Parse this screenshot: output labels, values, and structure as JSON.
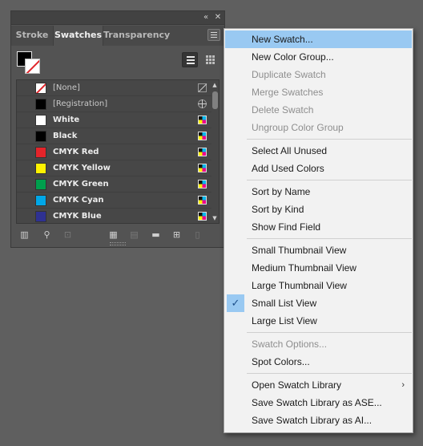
{
  "panel": {
    "titlebar_buttons": [
      "«",
      "✕"
    ],
    "tabs": [
      {
        "label": "Stroke",
        "active": false
      },
      {
        "label": "Swatches",
        "active": true
      },
      {
        "label": "Transparency",
        "active": false
      }
    ],
    "swatches": [
      {
        "name": "[None]",
        "color": "none",
        "type": "none"
      },
      {
        "name": "[Registration]",
        "color": "#000000",
        "type": "registration"
      },
      {
        "name": "White",
        "color": "#ffffff",
        "type": "cmyk"
      },
      {
        "name": "Black",
        "color": "#000000",
        "type": "cmyk"
      },
      {
        "name": "CMYK Red",
        "color": "#e5242a",
        "type": "cmyk"
      },
      {
        "name": "CMYK Yellow",
        "color": "#fff200",
        "type": "cmyk"
      },
      {
        "name": "CMYK Green",
        "color": "#009f4d",
        "type": "cmyk"
      },
      {
        "name": "CMYK Cyan",
        "color": "#00a7e8",
        "type": "cmyk"
      },
      {
        "name": "CMYK Blue",
        "color": "#2e3192",
        "type": "cmyk"
      }
    ],
    "bottom_tools": [
      "library-icon",
      "find-icon",
      "place-icon",
      "new-group-icon",
      "options-icon",
      "new-folder-icon",
      "new-swatch-icon",
      "trash-icon"
    ]
  },
  "menu": {
    "items": [
      {
        "label": "New Swatch...",
        "state": "highlight"
      },
      {
        "label": "New Color Group...",
        "state": "enabled"
      },
      {
        "label": "Duplicate Swatch",
        "state": "disabled"
      },
      {
        "label": "Merge Swatches",
        "state": "disabled"
      },
      {
        "label": "Delete Swatch",
        "state": "disabled"
      },
      {
        "label": "Ungroup Color Group",
        "state": "disabled"
      },
      {
        "label": "Select All Unused",
        "state": "enabled"
      },
      {
        "label": "Add Used Colors",
        "state": "enabled"
      },
      {
        "label": "Sort by Name",
        "state": "enabled"
      },
      {
        "label": "Sort by Kind",
        "state": "enabled"
      },
      {
        "label": "Show Find Field",
        "state": "enabled"
      },
      {
        "label": "Small Thumbnail View",
        "state": "enabled"
      },
      {
        "label": "Medium Thumbnail View",
        "state": "enabled"
      },
      {
        "label": "Large Thumbnail View",
        "state": "enabled"
      },
      {
        "label": "Small List View",
        "state": "checked"
      },
      {
        "label": "Large List View",
        "state": "enabled"
      },
      {
        "label": "Swatch Options...",
        "state": "disabled"
      },
      {
        "label": "Spot Colors...",
        "state": "enabled"
      },
      {
        "label": "Open Swatch Library",
        "state": "submenu"
      },
      {
        "label": "Save Swatch Library as ASE...",
        "state": "enabled"
      },
      {
        "label": "Save Swatch Library as AI...",
        "state": "enabled"
      }
    ],
    "checkmark": "✓",
    "submenu_arrow": "›",
    "highlight_color": "#99c9f2"
  }
}
